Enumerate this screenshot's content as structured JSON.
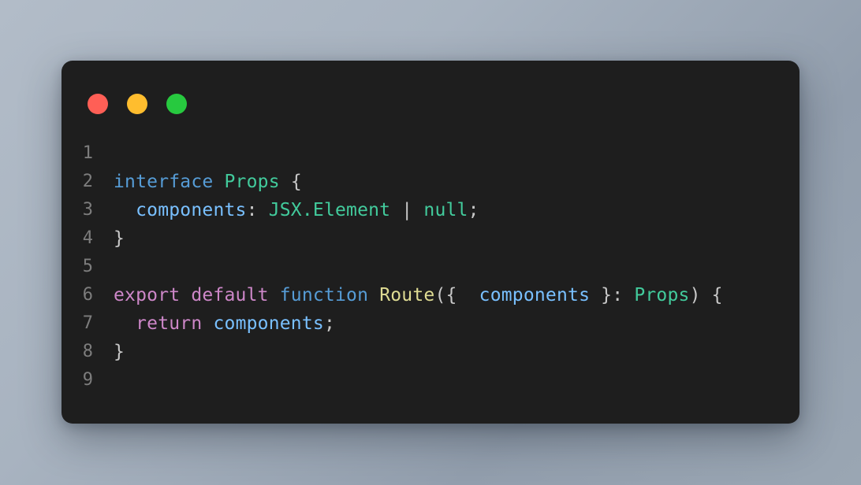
{
  "window": {
    "name": "code-snippet-window",
    "background_color": "#1e1e1e",
    "page_background": "#a8b3c0",
    "traffic_lights": [
      {
        "name": "close-button",
        "label": "Close",
        "color": "#ff5f56"
      },
      {
        "name": "minimize-button",
        "label": "Minimize",
        "color": "#ffbd2e"
      },
      {
        "name": "maximize-button",
        "label": "Maximize",
        "color": "#27c93f"
      }
    ]
  },
  "editor": {
    "language": "TypeScript",
    "line_numbers": [
      "1",
      "2",
      "3",
      "4",
      "5",
      "6",
      "7",
      "8",
      "9"
    ],
    "lines": [
      {
        "number": "1",
        "text": "",
        "tokens": []
      },
      {
        "number": "2",
        "text": "interface Props {",
        "tokens": [
          {
            "t": "interface",
            "c": "kw"
          },
          {
            "t": " ",
            "c": "punct"
          },
          {
            "t": "Props",
            "c": "type"
          },
          {
            "t": " ",
            "c": "punct"
          },
          {
            "t": "{",
            "c": "punct"
          }
        ]
      },
      {
        "number": "3",
        "text": "  components: JSX.Element | null;",
        "tokens": [
          {
            "t": "  ",
            "c": "punct"
          },
          {
            "t": "components",
            "c": "prop"
          },
          {
            "t": ": ",
            "c": "punct"
          },
          {
            "t": "JSX.Element",
            "c": "type"
          },
          {
            "t": " | ",
            "c": "punct"
          },
          {
            "t": "null",
            "c": "type"
          },
          {
            "t": ";",
            "c": "punct"
          }
        ]
      },
      {
        "number": "4",
        "text": "}",
        "tokens": [
          {
            "t": "}",
            "c": "punct"
          }
        ]
      },
      {
        "number": "5",
        "text": "",
        "tokens": []
      },
      {
        "number": "6",
        "text": "export default function Route({  components }: Props) {",
        "tokens": [
          {
            "t": "export default",
            "c": "mod"
          },
          {
            "t": " ",
            "c": "punct"
          },
          {
            "t": "function",
            "c": "kw"
          },
          {
            "t": " ",
            "c": "punct"
          },
          {
            "t": "Route",
            "c": "fn"
          },
          {
            "t": "({  ",
            "c": "punct"
          },
          {
            "t": "components",
            "c": "prop"
          },
          {
            "t": " }: ",
            "c": "punct"
          },
          {
            "t": "Props",
            "c": "type"
          },
          {
            "t": ") {",
            "c": "punct"
          }
        ]
      },
      {
        "number": "7",
        "text": "  return components;",
        "tokens": [
          {
            "t": "  ",
            "c": "punct"
          },
          {
            "t": "return",
            "c": "mod"
          },
          {
            "t": " ",
            "c": "punct"
          },
          {
            "t": "components",
            "c": "prop"
          },
          {
            "t": ";",
            "c": "punct"
          }
        ]
      },
      {
        "number": "8",
        "text": "}",
        "tokens": [
          {
            "t": "}",
            "c": "punct"
          }
        ]
      },
      {
        "number": "9",
        "text": "",
        "tokens": []
      }
    ]
  },
  "theme": {
    "keyword": "#569cd6",
    "modifier": "#cd87c8",
    "type": "#42cb9c",
    "function": "#dfdc93",
    "property": "#79c0ff",
    "punctuation": "#c8c8c8",
    "line_number": "#7d7d7d"
  }
}
